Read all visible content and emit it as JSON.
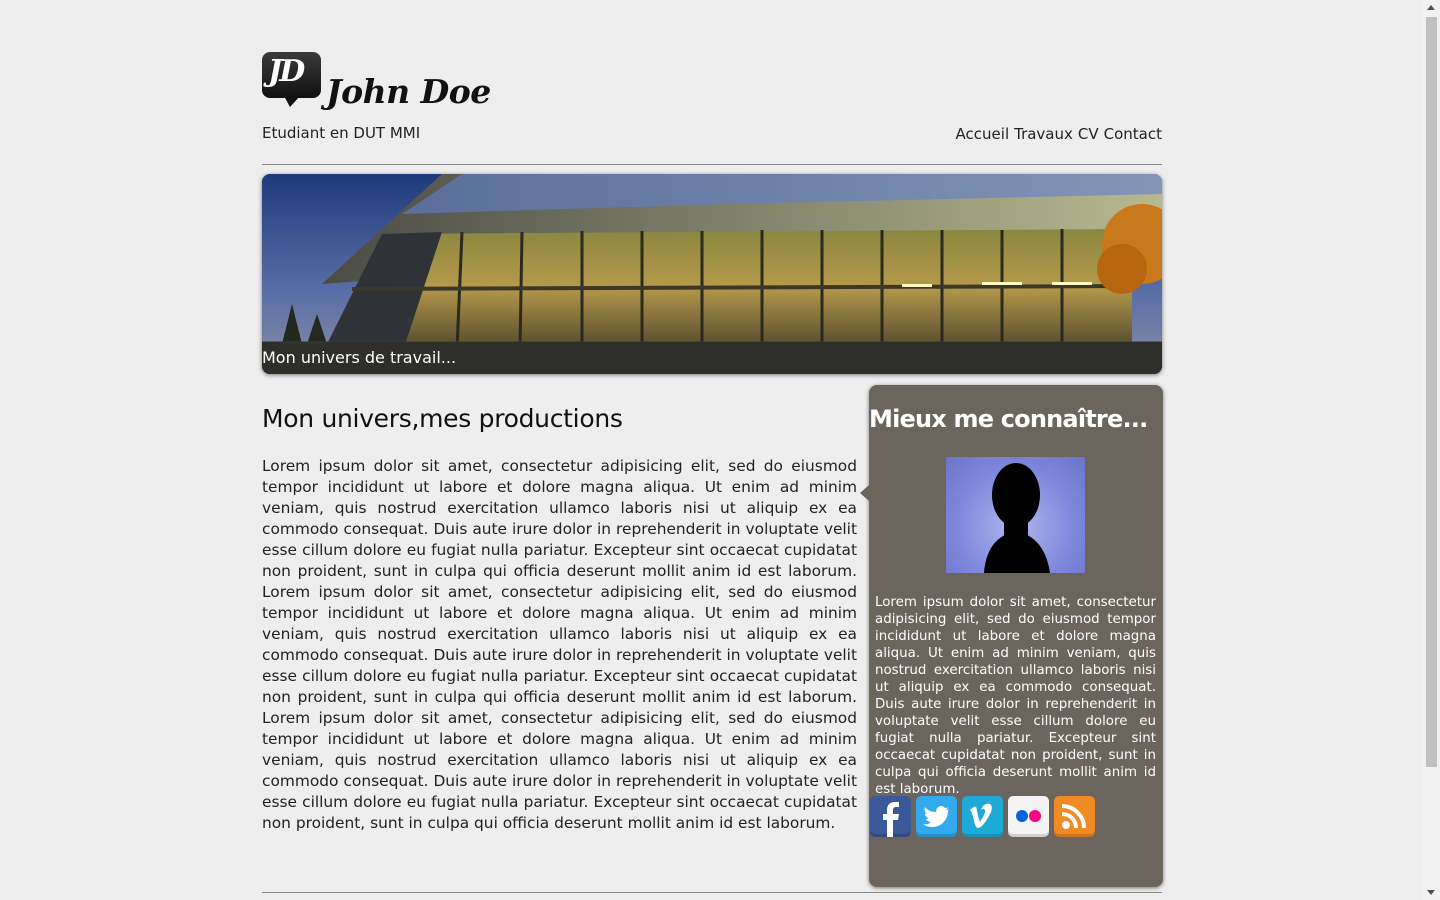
{
  "header": {
    "logo_monogram": "JD",
    "name": "John Doe",
    "subtitle": "Etudiant en DUT MMI"
  },
  "nav": {
    "items": [
      "Accueil",
      "Travaux",
      "CV",
      "Contact"
    ]
  },
  "banner": {
    "caption": "Mon univers de travail..."
  },
  "main": {
    "title": "Mon univers,mes productions",
    "text": "Lorem ipsum dolor sit amet, consectetur adipisicing elit, sed do eiusmod tempor incididunt ut labore et dolore magna aliqua. Ut enim ad minim veniam, quis nostrud exercitation ullamco laboris nisi ut aliquip ex ea commodo consequat. Duis aute irure dolor in reprehenderit in voluptate velit esse cillum dolore eu fugiat nulla pariatur. Excepteur sint occaecat cupidatat non proident, sunt in culpa qui officia deserunt mollit anim id est laborum. Lorem ipsum dolor sit amet, consectetur adipisicing elit, sed do eiusmod tempor incididunt ut labore et dolore magna aliqua. Ut enim ad minim veniam, quis nostrud exercitation ullamco laboris nisi ut aliquip ex ea commodo consequat. Duis aute irure dolor in reprehenderit in voluptate velit esse cillum dolore eu fugiat nulla pariatur. Excepteur sint occaecat cupidatat non proident, sunt in culpa qui officia deserunt mollit anim id est laborum. Lorem ipsum dolor sit amet, consectetur adipisicing elit, sed do eiusmod tempor incididunt ut labore et dolore magna aliqua. Ut enim ad minim veniam, quis nostrud exercitation ullamco laboris nisi ut aliquip ex ea commodo consequat. Duis aute irure dolor in reprehenderit in voluptate velit esse cillum dolore eu fugiat nulla pariatur. Excepteur sint occaecat cupidatat non proident, sunt in culpa qui officia deserunt mollit anim id est laborum."
  },
  "sidebar": {
    "title": "Mieux me connaître...",
    "text": "Lorem ipsum dolor sit amet, consectetur adipisicing elit, sed do eiusmod tempor incididunt ut labore et dolore magna aliqua. Ut enim ad minim veniam, quis nostrud exercitation ullamco laboris nisi ut aliquip ex ea commodo consequat. Duis aute irure dolor in reprehenderit in voluptate velit esse cillum dolore eu fugiat nulla pariatur. Excepteur sint occaecat cupidatat non proident, sunt in culpa qui officia deserunt mollit anim id est laborum.",
    "social": [
      {
        "name": "facebook-icon",
        "glyph": "f",
        "color": "#3b5998"
      },
      {
        "name": "twitter-icon",
        "glyph": "",
        "color": "#33aaee"
      },
      {
        "name": "vimeo-icon",
        "glyph": "v",
        "color": "#1eaad6"
      },
      {
        "name": "flickr-icon",
        "glyph": "",
        "color": "#f2f2f2"
      },
      {
        "name": "rss-icon",
        "glyph": "",
        "color": "#f08a24"
      }
    ]
  },
  "colors": {
    "background": "#eeeeee",
    "sidebar": "#6b655e",
    "text": "#222222"
  }
}
